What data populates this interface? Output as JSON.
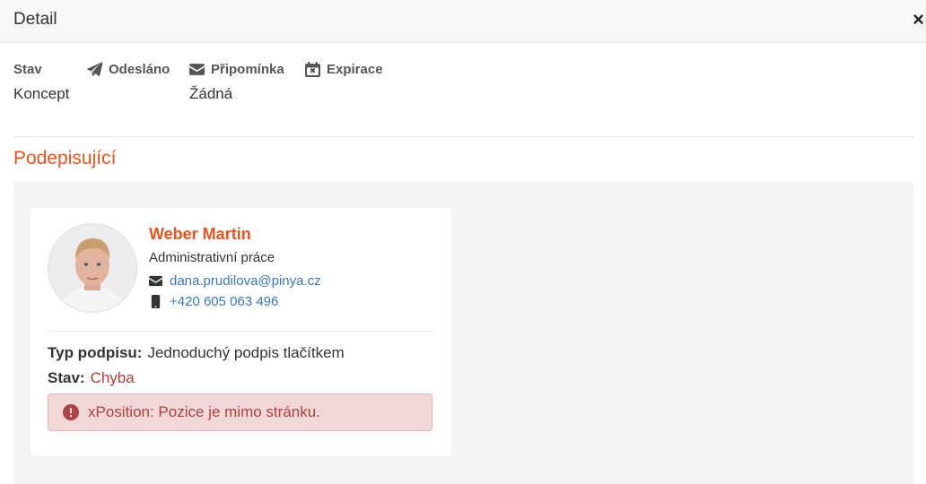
{
  "header": {
    "title": "Detail",
    "close_label": "×"
  },
  "info": {
    "status_label": "Stav",
    "status_value": "Koncept",
    "sent_label": "Odesláno",
    "sent_value": "",
    "reminder_label": "Připomínka",
    "reminder_value": "Žádná",
    "expiration_label": "Expirace",
    "expiration_value": ""
  },
  "signers_section": {
    "title": "Podepisující"
  },
  "signer": {
    "name": "Weber Martin",
    "role": "Administrativní práce",
    "email": "dana.prudilova@pinya.cz",
    "phone": "+420 605 063 496",
    "signature_type_label": "Typ podpisu:",
    "signature_type_value": "Jednoduchý podpis tlačítkem",
    "status_label": "Stav:",
    "status_value": "Chyba",
    "error_message": "xPosition: Pozice je mimo stránku."
  },
  "colors": {
    "accent": "#e8531d",
    "link": "#3a78b5",
    "error": "#a94442",
    "error_bg": "#f2d7d7"
  },
  "icons": [
    "close-icon",
    "paper-plane-icon",
    "envelope-icon",
    "calendar-x-icon",
    "envelope-icon",
    "mobile-phone-icon",
    "exclamation-circle-icon"
  ]
}
